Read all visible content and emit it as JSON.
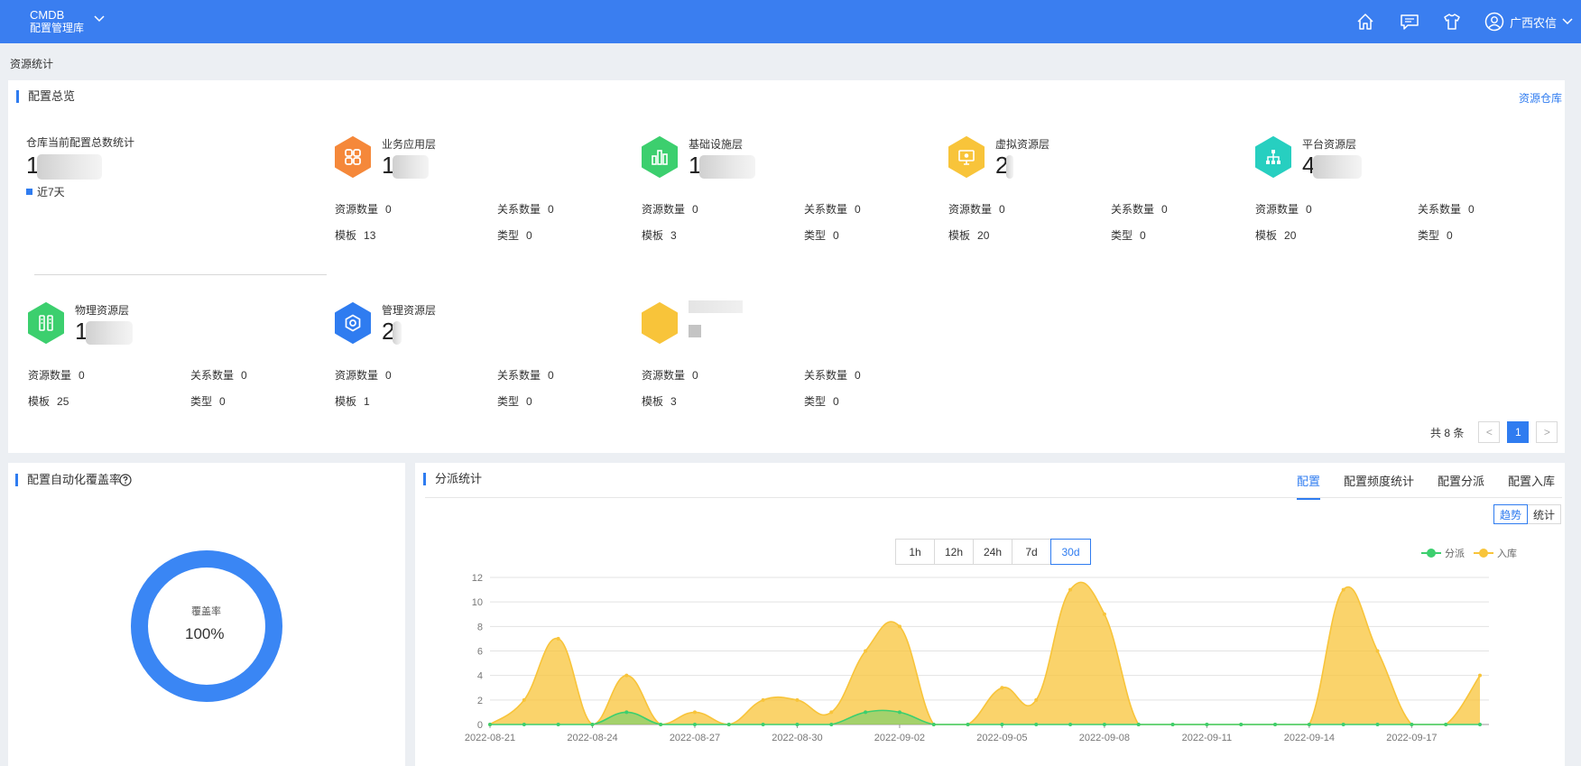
{
  "header": {
    "brand_line1": "CMDB",
    "brand_line2": "配置管理库",
    "user_name": "广西农信",
    "icons": [
      "home-icon",
      "message-icon",
      "shirt-icon",
      "user-icon"
    ]
  },
  "breadcrumb": "资源统计",
  "overview": {
    "title": "配置总览",
    "warehouse_link": "资源仓库",
    "total_label": "仓库当前配置总数统计",
    "total_value": "1",
    "legend": "近7天",
    "layers": [
      {
        "name": "业务应用层",
        "count": "1",
        "color": "#f5883a",
        "icon": "apps-icon",
        "stats": {
          "res_label": "资源数量",
          "res": "0",
          "rel_label": "关系数量",
          "rel": "0",
          "tpl_label": "模板",
          "tpl": "13",
          "type_label": "类型",
          "type": "0"
        }
      },
      {
        "name": "基础设施层",
        "count": "1",
        "color": "#3ccf6e",
        "icon": "bar-chart-icon",
        "stats": {
          "res_label": "资源数量",
          "res": "0",
          "rel_label": "关系数量",
          "rel": "0",
          "tpl_label": "模板",
          "tpl": "3",
          "type_label": "类型",
          "type": "0"
        }
      },
      {
        "name": "虚拟资源层",
        "count": "2",
        "color": "#f8c43a",
        "icon": "monitor-icon",
        "stats": {
          "res_label": "资源数量",
          "res": "0",
          "rel_label": "关系数量",
          "rel": "0",
          "tpl_label": "模板",
          "tpl": "20",
          "type_label": "类型",
          "type": "0"
        }
      },
      {
        "name": "平台资源层",
        "count": "4",
        "color": "#27cfc0",
        "icon": "hierarchy-icon",
        "stats": {
          "res_label": "资源数量",
          "res": "0",
          "rel_label": "关系数量",
          "rel": "0",
          "tpl_label": "模板",
          "tpl": "20",
          "type_label": "类型",
          "type": "0"
        }
      },
      {
        "name": "物理资源层",
        "count": "1",
        "color": "#3ccf6e",
        "icon": "server-icon",
        "stats": {
          "res_label": "资源数量",
          "res": "0",
          "rel_label": "关系数量",
          "rel": "0",
          "tpl_label": "模板",
          "tpl": "25",
          "type_label": "类型",
          "type": "0"
        }
      },
      {
        "name": "管理资源层",
        "count": "2",
        "color": "#2f7cf0",
        "icon": "gear-hex-icon",
        "stats": {
          "res_label": "资源数量",
          "res": "0",
          "rel_label": "关系数量",
          "rel": "0",
          "tpl_label": "模板",
          "tpl": "1",
          "type_label": "类型",
          "type": "0"
        }
      },
      {
        "name": "",
        "count": "",
        "color": "#f8c43a",
        "icon": "blank-icon",
        "stats": {
          "res_label": "资源数量",
          "res": "0",
          "rel_label": "关系数量",
          "rel": "0",
          "tpl_label": "模板",
          "tpl": "3",
          "type_label": "类型",
          "type": "0"
        }
      }
    ],
    "pager": {
      "total": "共 8 条",
      "prev": "<",
      "page": "1",
      "next": ">"
    }
  },
  "coverage": {
    "title": "配置自动化覆盖率",
    "help_icon": "question-circle-icon",
    "label": "覆盖率",
    "value": "100%",
    "ratio": 1.0,
    "color": "#3a86f4"
  },
  "dispatch": {
    "title": "分派统计",
    "tabs": [
      "配置",
      "配置频度统计",
      "配置分派",
      "配置入库"
    ],
    "active_tab": 0,
    "view_toggle": [
      "趋势",
      "统计"
    ],
    "active_view": 0,
    "ranges": [
      "1h",
      "12h",
      "24h",
      "7d",
      "30d"
    ],
    "active_range": 4
  },
  "chart_data": {
    "type": "area",
    "x": [
      "2022-08-21",
      "2022-08-22",
      "2022-08-23",
      "2022-08-24",
      "2022-08-25",
      "2022-08-26",
      "2022-08-27",
      "2022-08-28",
      "2022-08-29",
      "2022-08-30",
      "2022-08-31",
      "2022-09-01",
      "2022-09-02",
      "2022-09-03",
      "2022-09-04",
      "2022-09-05",
      "2022-09-06",
      "2022-09-07",
      "2022-09-08",
      "2022-09-09",
      "2022-09-10",
      "2022-09-11",
      "2022-09-12",
      "2022-09-13",
      "2022-09-14",
      "2022-09-15",
      "2022-09-16",
      "2022-09-17",
      "2022-09-18",
      "2022-09-19"
    ],
    "x_ticks": [
      "2022-08-21",
      "2022-08-24",
      "2022-08-27",
      "2022-08-30",
      "2022-09-02",
      "2022-09-05",
      "2022-09-08",
      "2022-09-11",
      "2022-09-14",
      "2022-09-17"
    ],
    "series": [
      {
        "name": "分派",
        "color": "#3ccf6e",
        "values": [
          0,
          0,
          0,
          0,
          1,
          0,
          0,
          0,
          0,
          0,
          0,
          1,
          1,
          0,
          0,
          0,
          0,
          0,
          0,
          0,
          0,
          0,
          0,
          0,
          0,
          0,
          0,
          0,
          0,
          0
        ]
      },
      {
        "name": "入库",
        "color": "#f8c43a",
        "values": [
          0,
          2,
          7,
          0,
          4,
          0,
          1,
          0,
          2,
          2,
          1,
          6,
          8,
          0,
          0,
          3,
          2,
          11,
          9,
          0,
          0,
          0,
          0,
          0,
          0,
          11,
          6,
          0,
          0,
          4
        ]
      }
    ],
    "ylim": [
      0,
      12
    ],
    "yticks": [
      0,
      2,
      4,
      6,
      8,
      10,
      12
    ],
    "legend_position": "top-right",
    "grid": true
  }
}
